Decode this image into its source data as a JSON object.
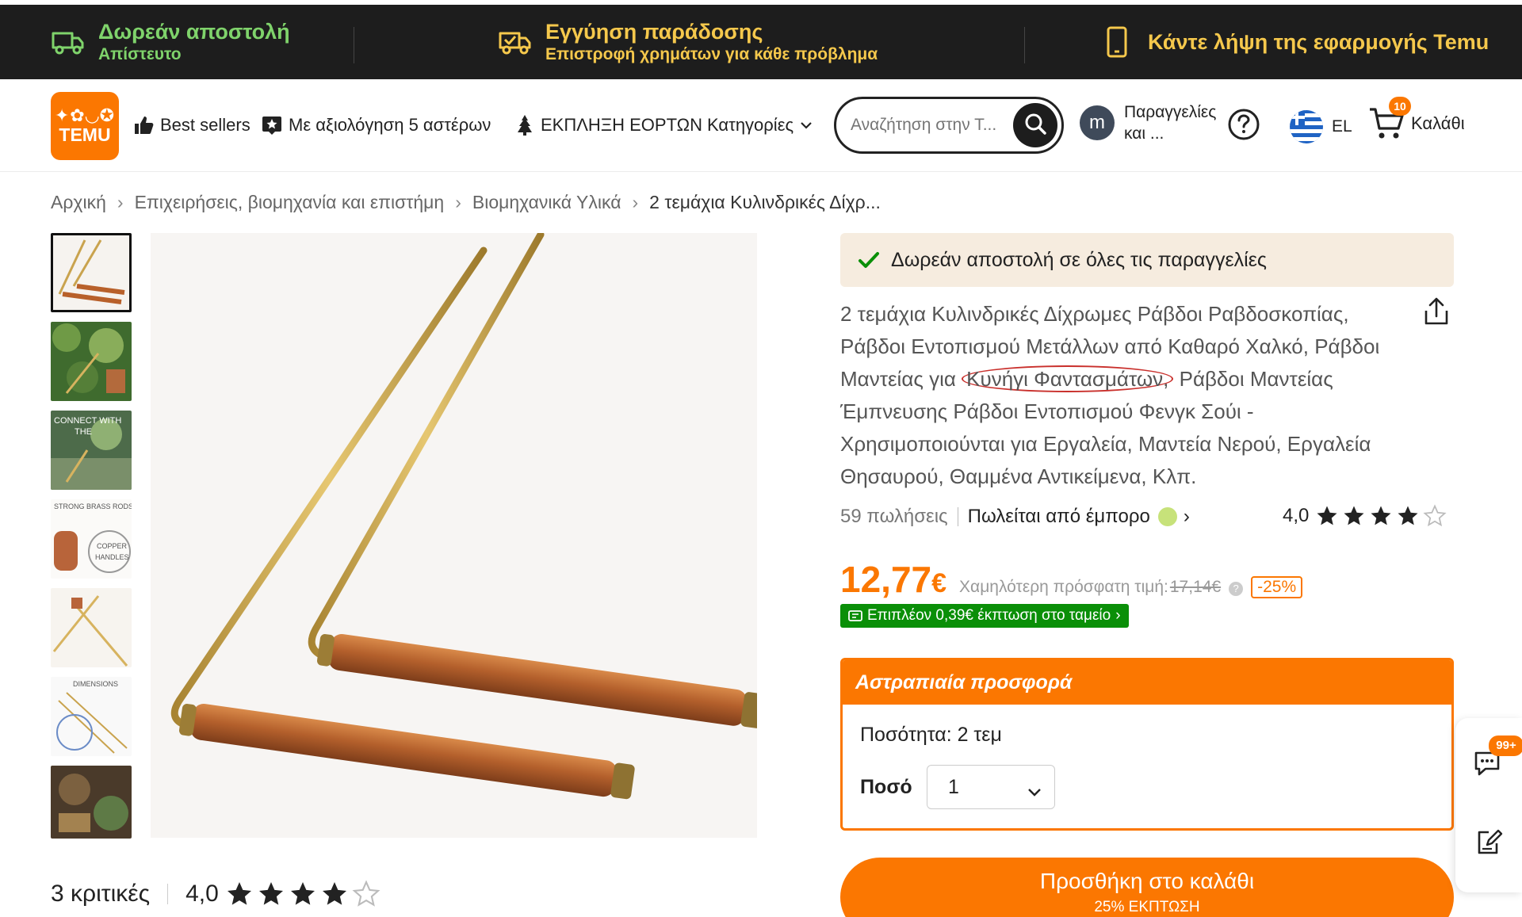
{
  "promo_bar": {
    "shipping_title": "Δωρεάν αποστολή",
    "shipping_sub": "Απίστευτο",
    "delivery_title": "Εγγύηση παράδοσης",
    "delivery_sub": "Επιστροφή χρημάτων για κάθε πρόβλημα",
    "app_label": "Κάντε λήψη της εφαρμογής Temu"
  },
  "header": {
    "logo_text": "TEMU",
    "nav": [
      {
        "label": "Best sellers",
        "icon": "thumbs-up-icon"
      },
      {
        "label": "Με αξιολόγηση 5 αστέρων",
        "icon": "star-badge-icon"
      },
      {
        "label": "ΕΚΠΛΗΞΗ ΕΟΡΤΩΝ",
        "icon": "christmas-tree-icon"
      },
      {
        "label": "Κατηγορίες",
        "icon": "chevron-down-icon"
      }
    ],
    "search_placeholder": "Αναζήτηση στην Τ...",
    "avatar_letter": "m",
    "orders_label": "Παραγγελίες και ...",
    "lang": "EL",
    "cart_label": "Καλάθι",
    "cart_count": "10"
  },
  "breadcrumb": [
    "Αρχική",
    "Επιχειρήσεις, βιομηχανία και επιστήμη",
    "Βιομηχανικά Υλικά",
    "2 τεμάχια Κυλινδρικές Δίχρ..."
  ],
  "product": {
    "free_shipping": "Δωρεάν αποστολή σε όλες τις παραγγελίες",
    "title_before": "2 τεμάχια Κυλινδρικές Δίχρωμες Ράβδοι Ραβδοσκοπίας, Ράβδοι Εντοπισμού Μετάλλων από Καθαρό Χαλκό, Ράβδοι Μαντείας για ",
    "title_circled": "Κυνήγι Φαντασμάτων,",
    "title_after": " Ράβδοι Μαντείας Έμπνευσης Ράβδοι Εντοπισμού Φενγκ Σούι - Χρησιμοποιούνται για Εργαλεία, Μαντεία Νερού, Εργαλεία Θησαυρού, Θαμμένα Αντικείμενα, Κλπ.",
    "sales": "59 πωλήσεις",
    "seller": "Πωλείται από έμπορο",
    "rating": "4,0",
    "rating_value": 4,
    "price_main": "12,77",
    "price_currency": "€",
    "lowest_label": "Χαμηλότερη πρόσφατη τιμή:",
    "old_price": "17,14€",
    "discount": "-25%",
    "extra_discount": "Επιπλέον 0,39€ έκπτωση στο ταμείο"
  },
  "flash": {
    "title": "Αστραπιαία προσφορά",
    "quantity": "Ποσότητα: 2 τεμ",
    "amount_label": "Ποσό",
    "amount_value": "1"
  },
  "add_to_cart": {
    "label": "Προσθήκη στο καλάθι",
    "sub": "25% ΕΚΠΤΩΣΗ"
  },
  "reviews": {
    "count_label": "3 κριτικές",
    "rating": "4,0",
    "rating_value": 4
  },
  "side": {
    "chat_badge": "99+"
  },
  "colors": {
    "brand_orange": "#fb7701",
    "topbar_bg": "#1d1d1d",
    "green_promo": "#7fd36b",
    "yellow_promo": "#f5c84c",
    "extra_green": "#0a8f08"
  }
}
